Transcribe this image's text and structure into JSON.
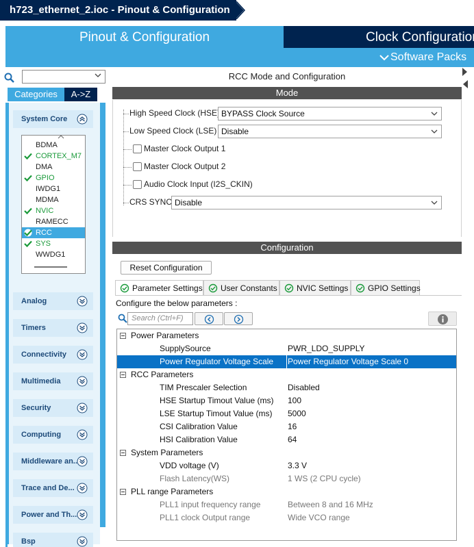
{
  "window": {
    "breadcrumb": "h723_ethernet_2.ioc - Pinout & Configuration"
  },
  "tabs": {
    "pinout": "Pinout & Configuration",
    "clock": "Clock Configuration",
    "software_packs": "Software Packs"
  },
  "left": {
    "search_placeholder": "",
    "categories_tab": "Categories",
    "az_tab": "A->Z",
    "categories": [
      {
        "label": "System Core",
        "expanded": true
      },
      {
        "label": "Analog",
        "expanded": false
      },
      {
        "label": "Timers",
        "expanded": false
      },
      {
        "label": "Connectivity",
        "expanded": false
      },
      {
        "label": "Multimedia",
        "expanded": false
      },
      {
        "label": "Security",
        "expanded": false
      },
      {
        "label": "Computing",
        "expanded": false
      },
      {
        "label": "Middleware an...",
        "expanded": false
      },
      {
        "label": "Trace and De...",
        "expanded": false
      },
      {
        "label": "Power and Th...",
        "expanded": false
      },
      {
        "label": "Bsp",
        "expanded": false
      }
    ],
    "system_core_items": [
      {
        "label": "BDMA",
        "status": "none"
      },
      {
        "label": "CORTEX_M7",
        "status": "ok"
      },
      {
        "label": "DMA",
        "status": "none"
      },
      {
        "label": "GPIO",
        "status": "ok"
      },
      {
        "label": "IWDG1",
        "status": "none"
      },
      {
        "label": "MDMA",
        "status": "none"
      },
      {
        "label": "NVIC",
        "status": "ok"
      },
      {
        "label": "RAMECC",
        "status": "none"
      },
      {
        "label": "RCC",
        "status": "selected"
      },
      {
        "label": "SYS",
        "status": "ok"
      },
      {
        "label": "WWDG1",
        "status": "none"
      }
    ]
  },
  "mode": {
    "panel_title": "RCC Mode and Configuration",
    "header": "Mode",
    "hse_label": "High Speed Clock (HSE)",
    "hse_value": "BYPASS Clock Source",
    "lse_label": "Low Speed Clock (LSE)",
    "lse_value": "Disable",
    "mco1_label": "Master Clock Output 1",
    "mco2_label": "Master Clock Output 2",
    "i2s_label": "Audio Clock Input (I2S_CKIN)",
    "crs_label": "CRS SYNC",
    "crs_value": "Disable"
  },
  "config": {
    "header": "Configuration",
    "reset_button": "Reset Configuration",
    "tabs": [
      "Parameter Settings",
      "User Constants",
      "NVIC Settings",
      "GPIO Settings"
    ],
    "instructions": "Configure the below parameters :",
    "search_placeholder": "Search (Ctrl+F)",
    "groups": {
      "power": "Power Parameters",
      "rcc": "RCC Parameters",
      "system": "System Parameters",
      "pll": "PLL range Parameters"
    },
    "rows": [
      {
        "name": "SupplySource",
        "value": "PWR_LDO_SUPPLY"
      },
      {
        "name": "Power Regulator Voltage Scale",
        "value": "Power Regulator Voltage Scale 0"
      },
      {
        "name": "TIM Prescaler Selection",
        "value": "Disabled"
      },
      {
        "name": "HSE Startup Timout Value (ms)",
        "value": "100"
      },
      {
        "name": "LSE Startup Timout Value (ms)",
        "value": "5000"
      },
      {
        "name": "CSI Calibration Value",
        "value": "16"
      },
      {
        "name": "HSI Calibration Value",
        "value": "64"
      },
      {
        "name": "VDD voltage (V)",
        "value": "3.3 V"
      },
      {
        "name": "Flash Latency(WS)",
        "value": "1 WS (2 CPU cycle)"
      },
      {
        "name": "PLL1 input frequency range",
        "value": "Between 8 and 16 MHz"
      },
      {
        "name": "PLL1 clock Output range",
        "value": "Wide VCO range"
      }
    ]
  },
  "colors": {
    "navy": "#00234f",
    "blue": "#3fa9e0",
    "select_blue": "#0a72c6",
    "ok_green": "#1a9a3a"
  }
}
